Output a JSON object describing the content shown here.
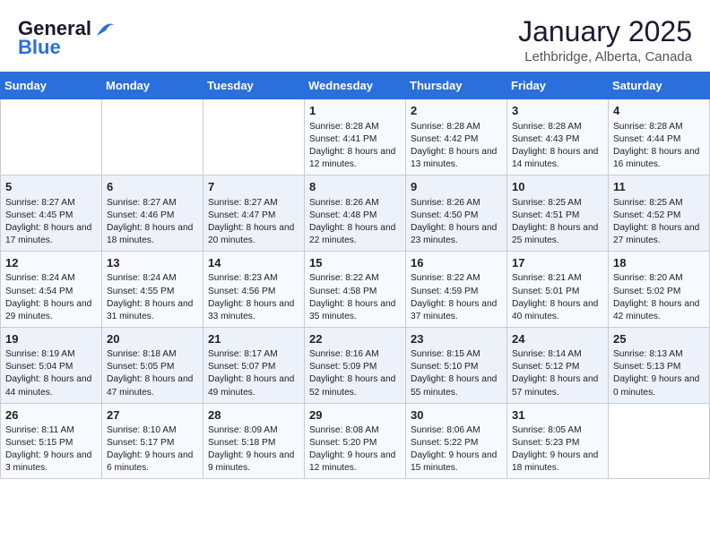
{
  "header": {
    "logo_general": "General",
    "logo_blue": "Blue",
    "month_title": "January 2025",
    "location": "Lethbridge, Alberta, Canada"
  },
  "weekdays": [
    "Sunday",
    "Monday",
    "Tuesday",
    "Wednesday",
    "Thursday",
    "Friday",
    "Saturday"
  ],
  "rows": [
    [
      {
        "day": "",
        "empty": true
      },
      {
        "day": "",
        "empty": true
      },
      {
        "day": "",
        "empty": true
      },
      {
        "day": "1",
        "sunrise": "Sunrise: 8:28 AM",
        "sunset": "Sunset: 4:41 PM",
        "daylight": "Daylight: 8 hours and 12 minutes."
      },
      {
        "day": "2",
        "sunrise": "Sunrise: 8:28 AM",
        "sunset": "Sunset: 4:42 PM",
        "daylight": "Daylight: 8 hours and 13 minutes."
      },
      {
        "day": "3",
        "sunrise": "Sunrise: 8:28 AM",
        "sunset": "Sunset: 4:43 PM",
        "daylight": "Daylight: 8 hours and 14 minutes."
      },
      {
        "day": "4",
        "sunrise": "Sunrise: 8:28 AM",
        "sunset": "Sunset: 4:44 PM",
        "daylight": "Daylight: 8 hours and 16 minutes."
      }
    ],
    [
      {
        "day": "5",
        "sunrise": "Sunrise: 8:27 AM",
        "sunset": "Sunset: 4:45 PM",
        "daylight": "Daylight: 8 hours and 17 minutes."
      },
      {
        "day": "6",
        "sunrise": "Sunrise: 8:27 AM",
        "sunset": "Sunset: 4:46 PM",
        "daylight": "Daylight: 8 hours and 18 minutes."
      },
      {
        "day": "7",
        "sunrise": "Sunrise: 8:27 AM",
        "sunset": "Sunset: 4:47 PM",
        "daylight": "Daylight: 8 hours and 20 minutes."
      },
      {
        "day": "8",
        "sunrise": "Sunrise: 8:26 AM",
        "sunset": "Sunset: 4:48 PM",
        "daylight": "Daylight: 8 hours and 22 minutes."
      },
      {
        "day": "9",
        "sunrise": "Sunrise: 8:26 AM",
        "sunset": "Sunset: 4:50 PM",
        "daylight": "Daylight: 8 hours and 23 minutes."
      },
      {
        "day": "10",
        "sunrise": "Sunrise: 8:25 AM",
        "sunset": "Sunset: 4:51 PM",
        "daylight": "Daylight: 8 hours and 25 minutes."
      },
      {
        "day": "11",
        "sunrise": "Sunrise: 8:25 AM",
        "sunset": "Sunset: 4:52 PM",
        "daylight": "Daylight: 8 hours and 27 minutes."
      }
    ],
    [
      {
        "day": "12",
        "sunrise": "Sunrise: 8:24 AM",
        "sunset": "Sunset: 4:54 PM",
        "daylight": "Daylight: 8 hours and 29 minutes."
      },
      {
        "day": "13",
        "sunrise": "Sunrise: 8:24 AM",
        "sunset": "Sunset: 4:55 PM",
        "daylight": "Daylight: 8 hours and 31 minutes."
      },
      {
        "day": "14",
        "sunrise": "Sunrise: 8:23 AM",
        "sunset": "Sunset: 4:56 PM",
        "daylight": "Daylight: 8 hours and 33 minutes."
      },
      {
        "day": "15",
        "sunrise": "Sunrise: 8:22 AM",
        "sunset": "Sunset: 4:58 PM",
        "daylight": "Daylight: 8 hours and 35 minutes."
      },
      {
        "day": "16",
        "sunrise": "Sunrise: 8:22 AM",
        "sunset": "Sunset: 4:59 PM",
        "daylight": "Daylight: 8 hours and 37 minutes."
      },
      {
        "day": "17",
        "sunrise": "Sunrise: 8:21 AM",
        "sunset": "Sunset: 5:01 PM",
        "daylight": "Daylight: 8 hours and 40 minutes."
      },
      {
        "day": "18",
        "sunrise": "Sunrise: 8:20 AM",
        "sunset": "Sunset: 5:02 PM",
        "daylight": "Daylight: 8 hours and 42 minutes."
      }
    ],
    [
      {
        "day": "19",
        "sunrise": "Sunrise: 8:19 AM",
        "sunset": "Sunset: 5:04 PM",
        "daylight": "Daylight: 8 hours and 44 minutes."
      },
      {
        "day": "20",
        "sunrise": "Sunrise: 8:18 AM",
        "sunset": "Sunset: 5:05 PM",
        "daylight": "Daylight: 8 hours and 47 minutes."
      },
      {
        "day": "21",
        "sunrise": "Sunrise: 8:17 AM",
        "sunset": "Sunset: 5:07 PM",
        "daylight": "Daylight: 8 hours and 49 minutes."
      },
      {
        "day": "22",
        "sunrise": "Sunrise: 8:16 AM",
        "sunset": "Sunset: 5:09 PM",
        "daylight": "Daylight: 8 hours and 52 minutes."
      },
      {
        "day": "23",
        "sunrise": "Sunrise: 8:15 AM",
        "sunset": "Sunset: 5:10 PM",
        "daylight": "Daylight: 8 hours and 55 minutes."
      },
      {
        "day": "24",
        "sunrise": "Sunrise: 8:14 AM",
        "sunset": "Sunset: 5:12 PM",
        "daylight": "Daylight: 8 hours and 57 minutes."
      },
      {
        "day": "25",
        "sunrise": "Sunrise: 8:13 AM",
        "sunset": "Sunset: 5:13 PM",
        "daylight": "Daylight: 9 hours and 0 minutes."
      }
    ],
    [
      {
        "day": "26",
        "sunrise": "Sunrise: 8:11 AM",
        "sunset": "Sunset: 5:15 PM",
        "daylight": "Daylight: 9 hours and 3 minutes."
      },
      {
        "day": "27",
        "sunrise": "Sunrise: 8:10 AM",
        "sunset": "Sunset: 5:17 PM",
        "daylight": "Daylight: 9 hours and 6 minutes."
      },
      {
        "day": "28",
        "sunrise": "Sunrise: 8:09 AM",
        "sunset": "Sunset: 5:18 PM",
        "daylight": "Daylight: 9 hours and 9 minutes."
      },
      {
        "day": "29",
        "sunrise": "Sunrise: 8:08 AM",
        "sunset": "Sunset: 5:20 PM",
        "daylight": "Daylight: 9 hours and 12 minutes."
      },
      {
        "day": "30",
        "sunrise": "Sunrise: 8:06 AM",
        "sunset": "Sunset: 5:22 PM",
        "daylight": "Daylight: 9 hours and 15 minutes."
      },
      {
        "day": "31",
        "sunrise": "Sunrise: 8:05 AM",
        "sunset": "Sunset: 5:23 PM",
        "daylight": "Daylight: 9 hours and 18 minutes."
      },
      {
        "day": "",
        "empty": true
      }
    ]
  ]
}
